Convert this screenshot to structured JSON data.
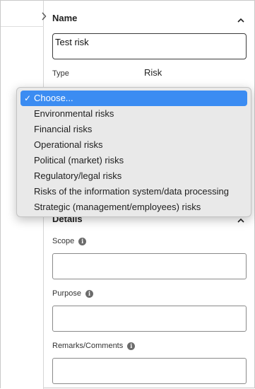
{
  "name_section": {
    "title": "Name",
    "name_value": "Test risk",
    "type_label": "Type",
    "type_value": "Risk"
  },
  "type_dropdown": {
    "selected_label": "Choose...",
    "options": [
      "Environmental risks",
      "Financial risks",
      "Operational risks",
      "Political (market) risks",
      "Regulatory/legal risks",
      "Risks of the information system/data processing",
      "Strategic (management/employees) risks"
    ]
  },
  "details_section": {
    "title": "Details",
    "scope_label": "Scope",
    "purpose_label": "Purpose",
    "remarks_label": "Remarks/Comments",
    "scope_value": "",
    "purpose_value": "",
    "remarks_value": ""
  },
  "icons": {
    "expand": "chevron-right-icon",
    "collapse": "chevron-up-icon",
    "info": "info-icon",
    "check": "checkmark-icon"
  },
  "colors": {
    "selection": "#3b8cf2",
    "menu_background": "#e9e9e9"
  }
}
